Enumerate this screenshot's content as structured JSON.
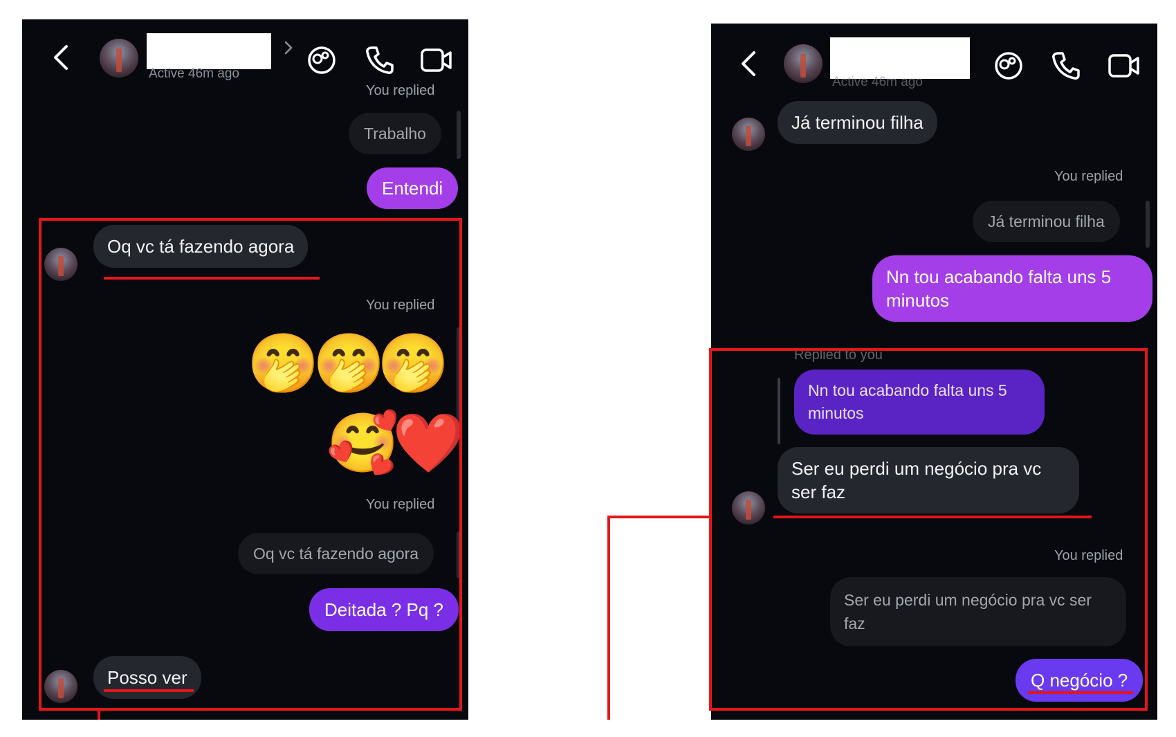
{
  "left": {
    "status": "Active 46m ago",
    "messages": {
      "you_replied_1": "You replied",
      "trabalho": "Trabalho",
      "entendi": "Entendi",
      "oq_vc": "Oq vc tá fazendo agora",
      "you_replied_2": "You replied",
      "emoji_row1": [
        "🤭",
        "🤭",
        "🤭"
      ],
      "emoji_row2": [
        "🥰",
        "❤️"
      ],
      "you_replied_3": "You replied",
      "quoted_oq_vc": "Oq vc tá fazendo agora",
      "deitada": "Deitada ? Pq ?",
      "posso_ver": "Posso ver"
    }
  },
  "right": {
    "status": "Active 46m ago",
    "messages": {
      "ja_terminou": "Já terminou filha",
      "you_replied_1": "You replied",
      "quoted_ja_terminou": "Já terminou filha",
      "nn_tou": "Nn tou acabando falta uns 5 minutos",
      "replied_to_you": "Replied to you",
      "quoted_nn_tou": "Nn tou acabando falta uns 5 minutos",
      "ser_eu": "Ser eu perdi um negócio pra vc ser faz",
      "you_replied_2": "You replied",
      "quoted_ser_eu": "Ser eu perdi um negócio pra vc ser faz",
      "q_negocio": "Q negócio ?"
    }
  },
  "colors": {
    "annotation_red": "#e3161b",
    "chat_bg": "#07090f",
    "bubble_gray": "#24272e",
    "bubble_purple": "#a43ee8",
    "bubble_violet": "#7a2fe6"
  }
}
